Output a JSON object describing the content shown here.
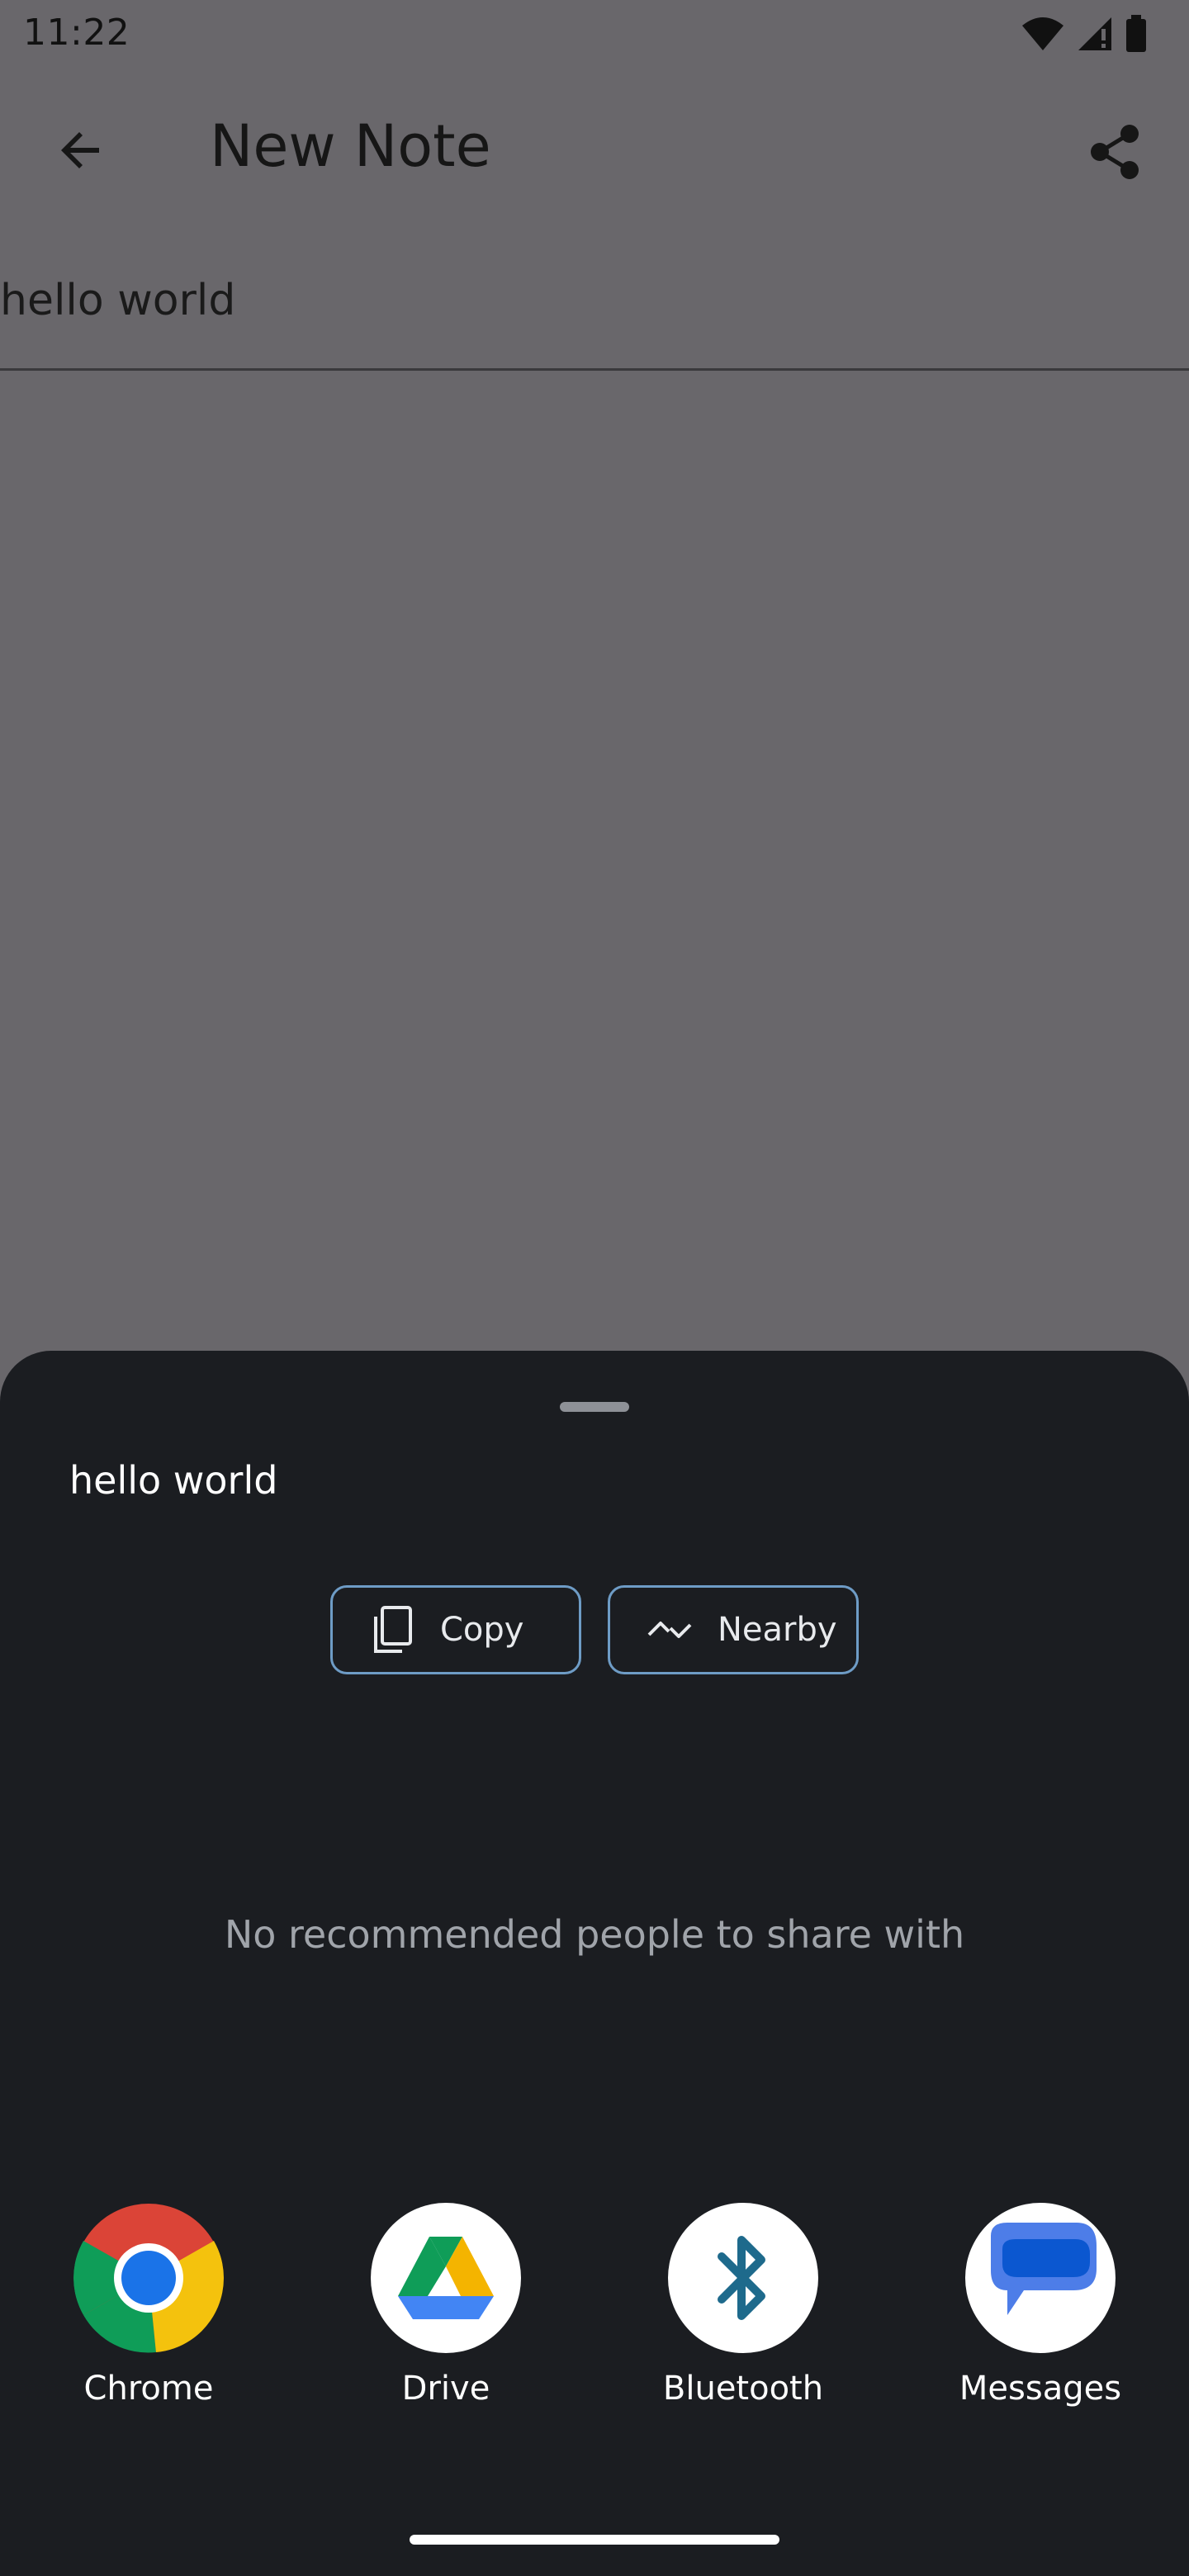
{
  "status_bar": {
    "time": "11:22",
    "icons": [
      "wifi-icon",
      "signal-icon",
      "battery-icon"
    ]
  },
  "app_bar": {
    "title": "New Note",
    "back_icon": "arrow-back-icon",
    "share_icon": "share-icon"
  },
  "note": {
    "text": "hello world"
  },
  "share_sheet": {
    "preview_text": "hello world",
    "actions": [
      {
        "label": "Copy",
        "icon": "copy-icon"
      },
      {
        "label": "Nearby",
        "icon": "nearby-icon"
      }
    ],
    "empty_people_message": "No recommended people to share with",
    "apps": [
      {
        "label": "Chrome",
        "icon": "chrome-icon"
      },
      {
        "label": "Drive",
        "icon": "drive-icon"
      },
      {
        "label": "Bluetooth",
        "icon": "bluetooth-icon"
      },
      {
        "label": "Messages",
        "icon": "messages-icon"
      }
    ]
  },
  "colors": {
    "scrim_background": "#69676b",
    "sheet_background": "#1b1d21",
    "action_border": "#6e9cc6",
    "bluetooth_blue": "#1e6a8c",
    "messages_blue": "#0b57d0"
  }
}
